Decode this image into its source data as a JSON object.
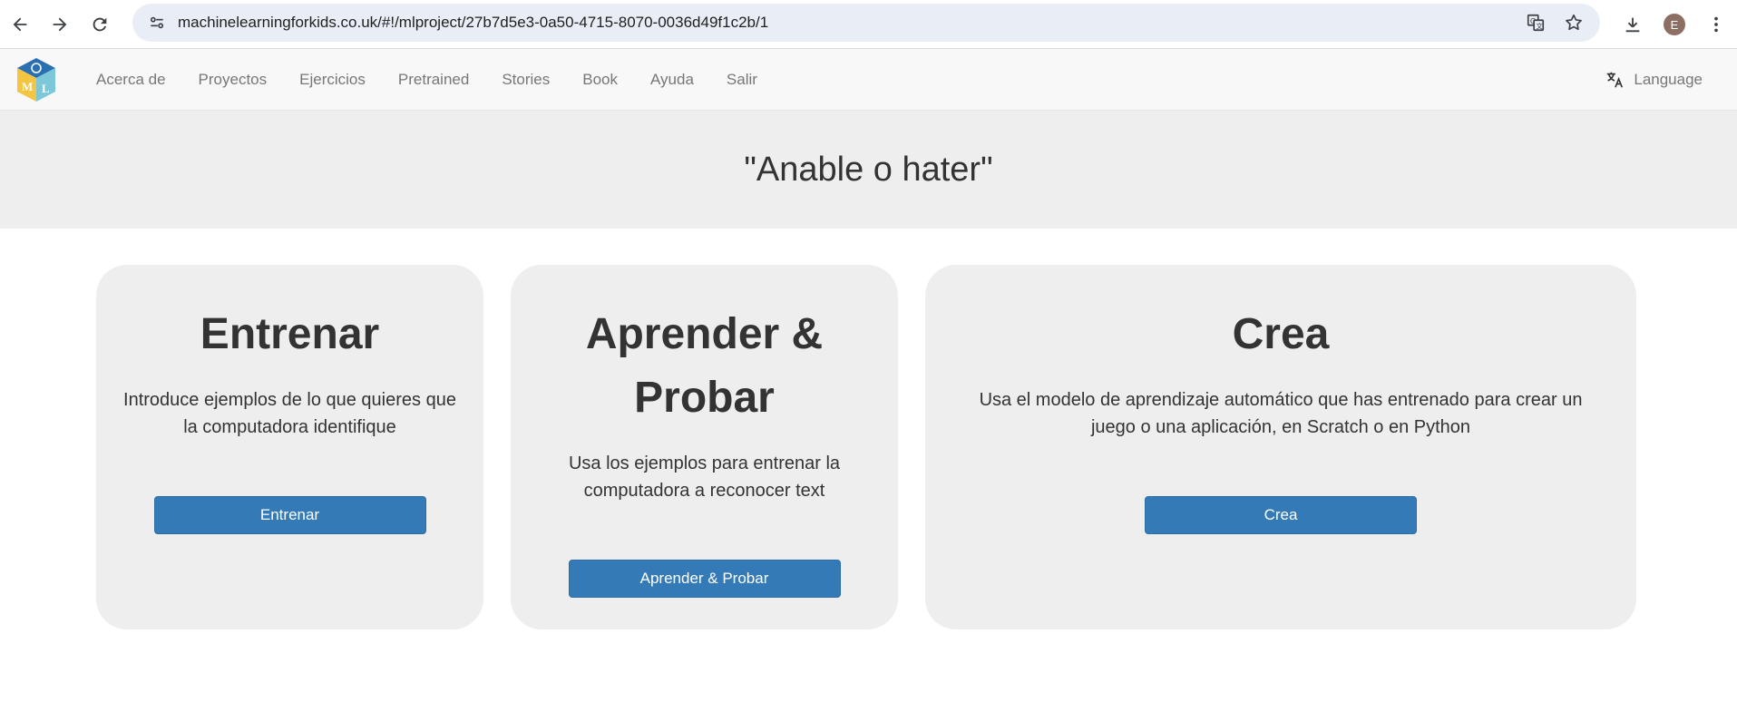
{
  "browser": {
    "url": "machinelearningforkids.co.uk/#!/mlproject/27b7d5e3-0a50-4715-8070-0036d49f1c2b/1",
    "avatar_initial": "E"
  },
  "navbar": {
    "links": [
      {
        "label": "Acerca de"
      },
      {
        "label": "Proyectos"
      },
      {
        "label": "Ejercicios"
      },
      {
        "label": "Pretrained"
      },
      {
        "label": "Stories"
      },
      {
        "label": "Book"
      },
      {
        "label": "Ayuda"
      },
      {
        "label": "Salir"
      }
    ],
    "language_label": "Language"
  },
  "banner": {
    "title": "\"Anable o hater\""
  },
  "cards": {
    "train": {
      "title": "Entrenar",
      "description": "Introduce ejemplos de lo que quieres que la computadora identifique",
      "button_label": "Entrenar"
    },
    "learn": {
      "title": "Aprender & Probar",
      "description": "Usa los ejemplos para entrenar la computadora a reconocer text",
      "button_label": "Aprender & Probar"
    },
    "make": {
      "title": "Crea",
      "description": "Usa el modelo de aprendizaje automático que has entrenado para crear un juego o una aplicación, en Scratch o en Python",
      "button_label": "Crea"
    }
  },
  "colors": {
    "primary_button": "#337ab7",
    "card_bg": "#eeeeee",
    "navbar_bg": "#f8f8f8"
  }
}
